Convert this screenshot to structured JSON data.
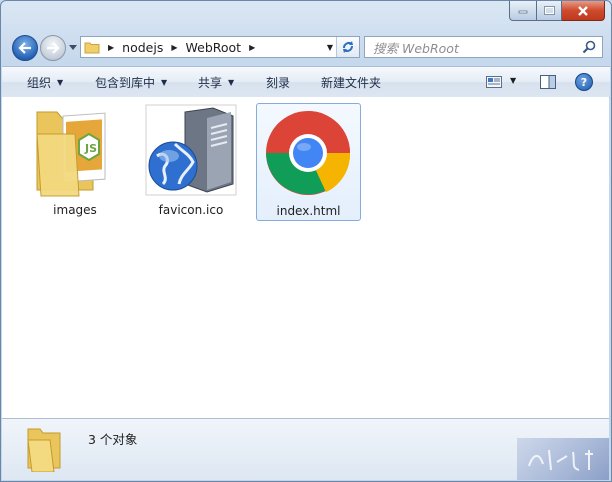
{
  "window": {
    "caption_buttons": [
      "minimize-icon",
      "maximize-icon",
      "close-icon"
    ]
  },
  "navigation": {
    "breadcrumb": [
      "nodejs",
      "WebRoot"
    ],
    "search_placeholder": "搜索 WebRoot"
  },
  "toolbar": {
    "organize": "组织",
    "include_in_library": "包含到库中",
    "share": "共享",
    "burn": "刻录",
    "new_folder": "新建文件夹",
    "help": "?"
  },
  "files": [
    {
      "name": "images",
      "icon": "folder-icon",
      "selected": false
    },
    {
      "name": "favicon.ico",
      "icon": "server-globe-icon",
      "selected": false
    },
    {
      "name": "index.html",
      "icon": "chrome-icon",
      "selected": true
    }
  ],
  "details": {
    "count_text": "3 个对象"
  },
  "colors": {
    "accent": "#2563b6",
    "selection_border": "#84acdd",
    "chrome_red": "#db4437",
    "chrome_green": "#0f9d58",
    "chrome_yellow": "#f4b400",
    "chrome_blue": "#4285f4"
  }
}
